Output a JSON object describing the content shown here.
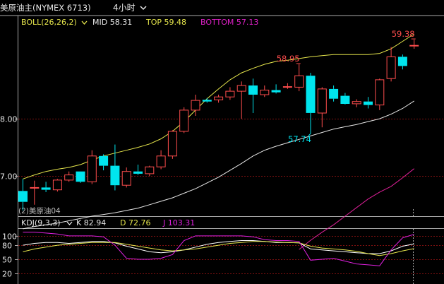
{
  "header": {
    "symbol_label": "美原油主(NYMEX 6713)",
    "period_label": "4小时"
  },
  "boll": {
    "label": "BOLL(26,26,2)",
    "mid_label": "MID 58.31",
    "top_label": "TOP 59.48",
    "bottom_label": "BOTTOM 57.13"
  },
  "kdj": {
    "label": "KDJ(9,3,3)",
    "k_label": "K 82.94",
    "d_label": "D 72.76",
    "j_label": "J 103.31"
  },
  "annotations": {
    "high_left": "58.95",
    "low": "57.74",
    "high_right": "59.38",
    "watermark": "(2)美原油04"
  },
  "colors": {
    "up": "#ff4d4d",
    "down": "#00e5ee",
    "top_band": "#e6e64c",
    "mid_band": "#e8e8e8",
    "bottom_band": "#e0209a",
    "k": "#ffffff",
    "d": "#e6e64c",
    "j": "#e020e0",
    "grid": "#7a1010"
  },
  "chart_data": [
    {
      "type": "candlestick",
      "title": "",
      "y_tick_labels": [
        "8.00",
        "7.00"
      ],
      "y_ticks": [
        58.0,
        57.0
      ],
      "ylim": [
        56.3,
        59.8
      ],
      "candles": [
        {
          "o": 56.74,
          "h": 56.95,
          "l": 56.4,
          "c": 56.55
        },
        {
          "o": 56.8,
          "h": 56.92,
          "l": 56.5,
          "c": 56.8
        },
        {
          "o": 56.8,
          "h": 56.9,
          "l": 56.72,
          "c": 56.76
        },
        {
          "o": 56.76,
          "h": 56.95,
          "l": 56.73,
          "c": 56.93
        },
        {
          "o": 56.93,
          "h": 57.08,
          "l": 56.9,
          "c": 57.02
        },
        {
          "o": 57.08,
          "h": 57.08,
          "l": 56.88,
          "c": 56.9
        },
        {
          "o": 56.9,
          "h": 57.45,
          "l": 56.86,
          "c": 57.35
        },
        {
          "o": 57.35,
          "h": 57.38,
          "l": 57.1,
          "c": 57.18
        },
        {
          "o": 57.18,
          "h": 57.55,
          "l": 56.75,
          "c": 56.84
        },
        {
          "o": 56.84,
          "h": 57.15,
          "l": 56.8,
          "c": 57.08
        },
        {
          "o": 57.08,
          "h": 57.2,
          "l": 57.02,
          "c": 57.04
        },
        {
          "o": 57.04,
          "h": 57.18,
          "l": 57.0,
          "c": 57.16
        },
        {
          "o": 57.16,
          "h": 57.45,
          "l": 57.12,
          "c": 57.35
        },
        {
          "o": 57.35,
          "h": 57.8,
          "l": 57.3,
          "c": 57.78
        },
        {
          "o": 57.78,
          "h": 58.2,
          "l": 57.75,
          "c": 58.15
        },
        {
          "o": 58.15,
          "h": 58.42,
          "l": 58.05,
          "c": 58.32
        },
        {
          "o": 58.33,
          "h": 58.36,
          "l": 58.28,
          "c": 58.3
        },
        {
          "o": 58.33,
          "h": 58.42,
          "l": 58.28,
          "c": 58.38
        },
        {
          "o": 58.38,
          "h": 58.55,
          "l": 58.33,
          "c": 58.48
        },
        {
          "o": 58.48,
          "h": 58.65,
          "l": 58.0,
          "c": 58.58
        },
        {
          "o": 58.58,
          "h": 58.7,
          "l": 58.1,
          "c": 58.42
        },
        {
          "o": 58.42,
          "h": 58.58,
          "l": 58.38,
          "c": 58.5
        },
        {
          "o": 58.5,
          "h": 58.6,
          "l": 58.44,
          "c": 58.46
        },
        {
          "o": 58.55,
          "h": 58.62,
          "l": 58.52,
          "c": 58.56
        },
        {
          "o": 58.55,
          "h": 58.95,
          "l": 58.48,
          "c": 58.75
        },
        {
          "o": 58.75,
          "h": 58.8,
          "l": 57.74,
          "c": 58.1
        },
        {
          "o": 58.1,
          "h": 58.55,
          "l": 57.85,
          "c": 58.52
        },
        {
          "o": 58.52,
          "h": 58.58,
          "l": 58.3,
          "c": 58.35
        },
        {
          "o": 58.4,
          "h": 58.45,
          "l": 58.25,
          "c": 58.26
        },
        {
          "o": 58.26,
          "h": 58.34,
          "l": 58.2,
          "c": 58.3
        },
        {
          "o": 58.3,
          "h": 58.38,
          "l": 58.18,
          "c": 58.24
        },
        {
          "o": 58.24,
          "h": 58.7,
          "l": 58.15,
          "c": 58.68
        },
        {
          "o": 58.7,
          "h": 59.25,
          "l": 58.65,
          "c": 59.08
        },
        {
          "o": 59.08,
          "h": 59.12,
          "l": 58.86,
          "c": 58.92
        },
        {
          "o": 59.28,
          "h": 59.38,
          "l": 59.22,
          "c": 59.28
        }
      ],
      "boll_top": [
        56.95,
        57.02,
        57.08,
        57.12,
        57.15,
        57.2,
        57.28,
        57.35,
        57.4,
        57.45,
        57.5,
        57.56,
        57.65,
        57.78,
        57.95,
        58.15,
        58.35,
        58.52,
        58.68,
        58.8,
        58.88,
        58.95,
        59.0,
        59.02,
        59.05,
        59.08,
        59.1,
        59.12,
        59.12,
        59.12,
        59.12,
        59.14,
        59.22,
        59.35,
        59.48
      ],
      "boll_mid": [
        56.08,
        56.12,
        56.15,
        56.18,
        56.22,
        56.26,
        56.3,
        56.33,
        56.36,
        56.4,
        56.44,
        56.5,
        56.56,
        56.62,
        56.7,
        56.78,
        56.88,
        56.98,
        57.1,
        57.22,
        57.35,
        57.45,
        57.52,
        57.58,
        57.64,
        57.7,
        57.76,
        57.82,
        57.86,
        57.9,
        57.95,
        58.0,
        58.08,
        58.18,
        58.31
      ],
      "boll_bottom": [
        null,
        null,
        null,
        null,
        null,
        null,
        null,
        null,
        null,
        null,
        null,
        null,
        null,
        null,
        null,
        null,
        null,
        null,
        null,
        null,
        null,
        null,
        null,
        null,
        55.72,
        55.88,
        56.02,
        56.15,
        56.3,
        56.45,
        56.6,
        56.72,
        56.82,
        56.97,
        57.13
      ],
      "price_annotations": [
        {
          "text": "58.95",
          "value": 58.95,
          "candle": 24
        },
        {
          "text": "57.74",
          "value": 57.74,
          "candle": 25
        },
        {
          "text": "59.38",
          "value": 59.38,
          "candle": 34
        }
      ]
    },
    {
      "type": "line",
      "title": "",
      "y_tick_labels": [
        "100",
        "80",
        "50",
        "20"
      ],
      "y_ticks": [
        100,
        80,
        50,
        20
      ],
      "ylim": [
        0,
        115
      ],
      "series": [
        {
          "name": "K",
          "values": [
            80,
            84,
            86,
            86,
            84,
            86,
            88,
            88,
            85,
            78,
            72,
            66,
            64,
            66,
            70,
            76,
            82,
            86,
            88,
            90,
            90,
            88,
            86,
            86,
            85,
            72,
            70,
            68,
            66,
            64,
            62,
            62,
            68,
            78,
            82.94
          ]
        },
        {
          "name": "D",
          "values": [
            66,
            72,
            76,
            80,
            82,
            84,
            86,
            86,
            86,
            82,
            78,
            74,
            70,
            68,
            70,
            72,
            76,
            80,
            84,
            86,
            88,
            88,
            87,
            86,
            85,
            78,
            74,
            72,
            70,
            67,
            62,
            58,
            62,
            68,
            72.76
          ]
        },
        {
          "name": "J",
          "values": [
            108,
            108,
            106,
            104,
            100,
            100,
            100,
            98,
            80,
            52,
            50,
            50,
            52,
            60,
            90,
            100,
            100,
            100,
            100,
            100,
            98,
            92,
            90,
            90,
            88,
            48,
            50,
            52,
            46,
            40,
            38,
            36,
            70,
            96,
            103.31
          ]
        }
      ]
    }
  ]
}
